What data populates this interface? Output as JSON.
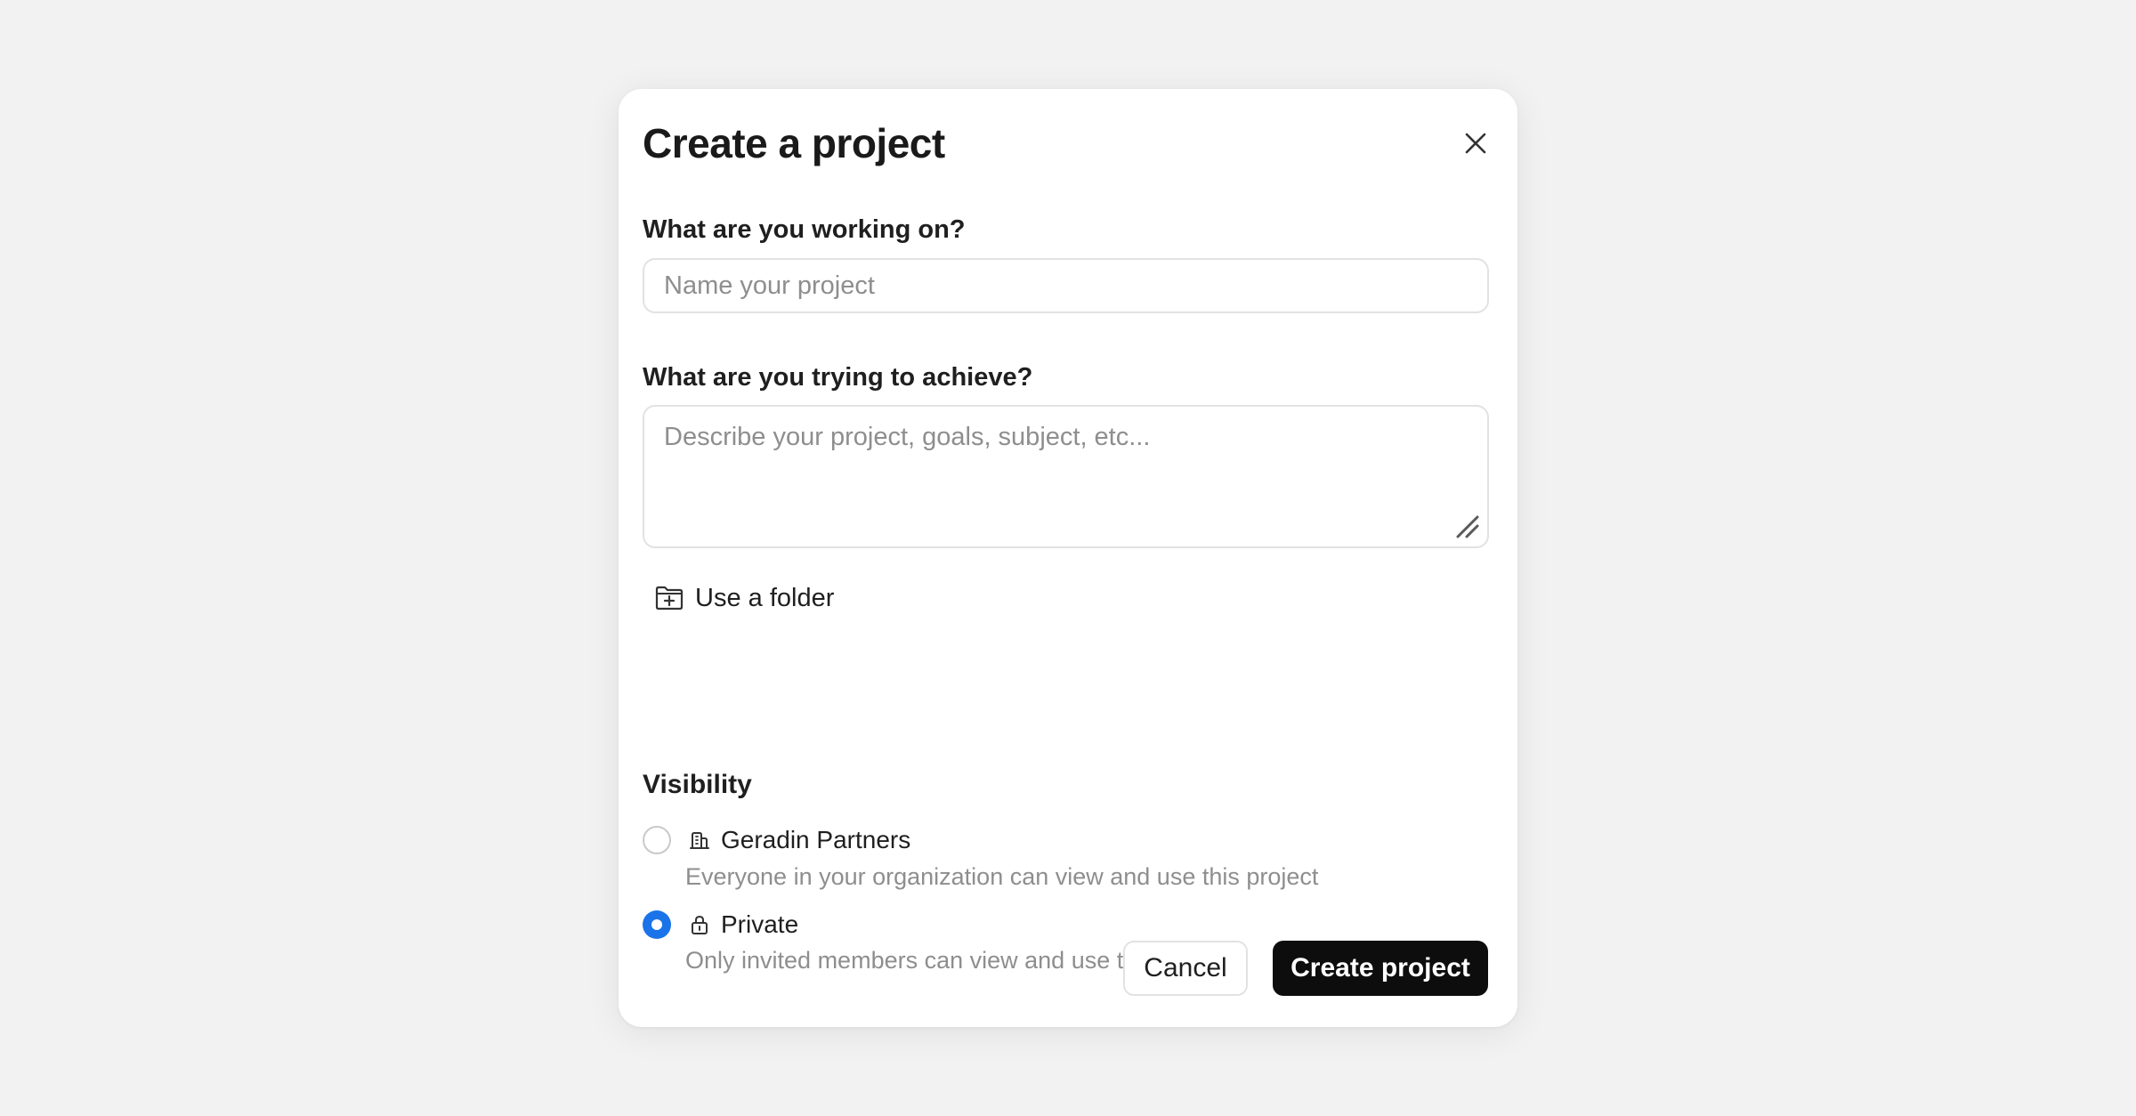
{
  "dialog": {
    "title": "Create a project",
    "close_icon": "close-icon"
  },
  "name_field": {
    "label": "What are you working on?",
    "placeholder": "Name your project",
    "value": ""
  },
  "description_field": {
    "label": "What are you trying to achieve?",
    "placeholder": "Describe your project, goals, subject, etc...",
    "value": ""
  },
  "folder": {
    "label": "Use a folder",
    "icon": "folder-plus-icon"
  },
  "visibility": {
    "label": "Visibility",
    "options": [
      {
        "title": "Geradin Partners",
        "description": "Everyone in your organization can view and use this project",
        "icon": "building-icon",
        "selected": false
      },
      {
        "title": "Private",
        "description": "Only invited members can view and use this project",
        "icon": "lock-icon",
        "selected": true
      }
    ]
  },
  "actions": {
    "cancel_label": "Cancel",
    "create_label": "Create project"
  },
  "colors": {
    "accent": "#1a73e8",
    "primary_button": "#0d0d0d",
    "background": "#f2f2f2"
  }
}
